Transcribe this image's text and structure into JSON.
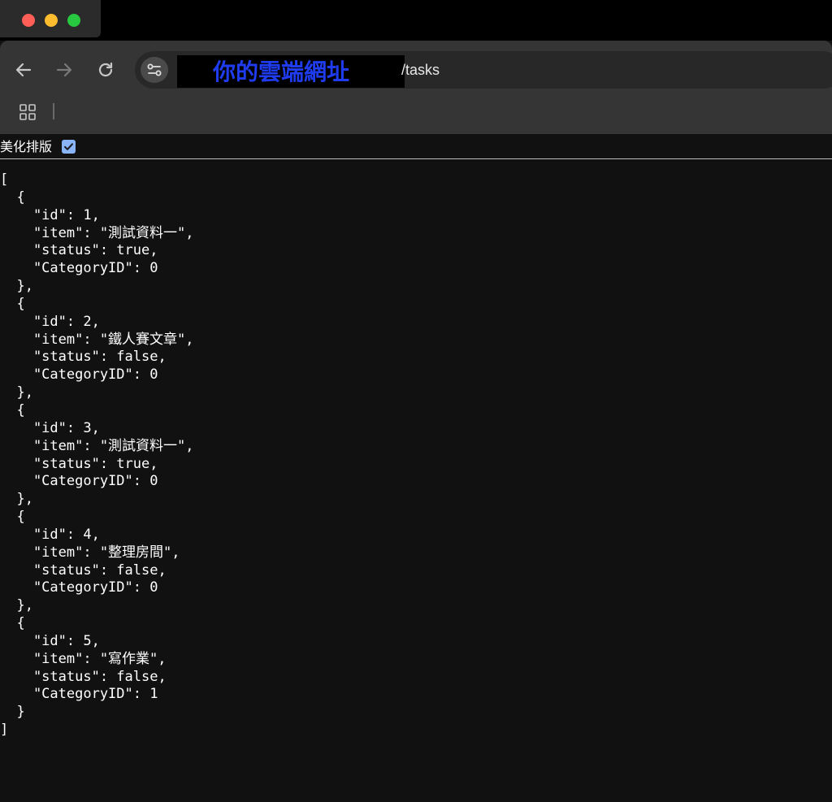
{
  "browser": {
    "address_bar": {
      "redacted_label": "你的雲端網址",
      "url_suffix": "/tasks"
    },
    "icons": {
      "back": "arrow-left-icon",
      "forward": "arrow-right-icon",
      "reload": "reload-icon",
      "site_info": "tune-icon",
      "apps": "apps-grid-icon"
    }
  },
  "pretty_print": {
    "label": "美化排版",
    "checked": true,
    "accent": "#8ab4f8"
  },
  "json_text": "[\n  {\n    \"id\": 1,\n    \"item\": \"測試資料一\",\n    \"status\": true,\n    \"CategoryID\": 0\n  },\n  {\n    \"id\": 2,\n    \"item\": \"鐵人賽文章\",\n    \"status\": false,\n    \"CategoryID\": 0\n  },\n  {\n    \"id\": 3,\n    \"item\": \"測試資料一\",\n    \"status\": true,\n    \"CategoryID\": 0\n  },\n  {\n    \"id\": 4,\n    \"item\": \"整理房間\",\n    \"status\": false,\n    \"CategoryID\": 0\n  },\n  {\n    \"id\": 5,\n    \"item\": \"寫作業\",\n    \"status\": false,\n    \"CategoryID\": 1\n  }\n]"
}
